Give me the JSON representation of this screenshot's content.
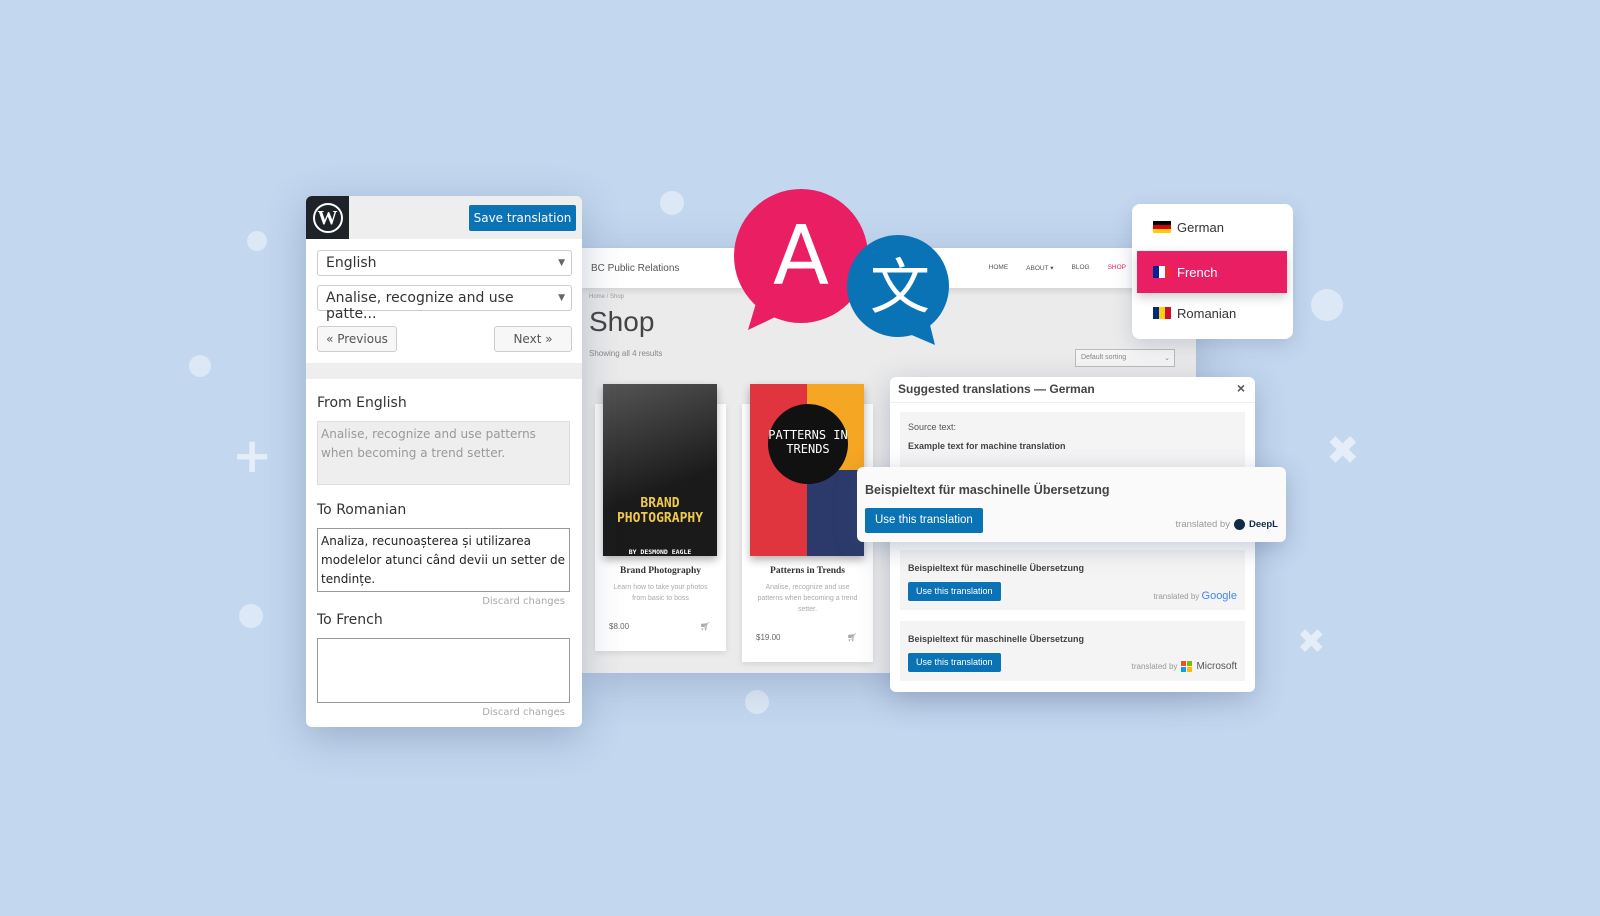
{
  "editor": {
    "save_label": "Save translation",
    "language_select": "English",
    "string_select": "Analise, recognize and use patte...",
    "previous_label": "« Previous",
    "next_label": "Next »",
    "from_label": "From English",
    "from_text": "Analise, recognize and use patterns when becoming a trend setter.",
    "to_romanian_label": "To Romanian",
    "to_romanian_text": "Analiza, recunoașterea și utilizarea modelelor atunci când devii un setter de tendințe.",
    "discard_label": "Discard changes",
    "to_french_label": "To French",
    "to_french_text": ""
  },
  "shop": {
    "site_title": "BC Public Relations",
    "menu": [
      "HOME",
      "ABOUT ▾",
      "BLOG",
      "SHOP"
    ],
    "active_menu_color": "#e91e63",
    "breadcrumb": "Home / Shop",
    "title": "Shop",
    "result_count": "Showing all 4 results",
    "sorting": "Default sorting",
    "products": [
      {
        "name": "Brand Photography",
        "desc": "Learn how to take your photos from basic to boss",
        "price": "$8.00",
        "cover_title": "BRAND PHOTOGRAPHY",
        "cover_author": "BY DESMOND EAGLE"
      },
      {
        "name": "Patterns in Trends",
        "desc": "Analise, recognize and use patterns when becoming a trend setter.",
        "price": "$19.00",
        "cover_title": "PATTERNS IN TRENDS"
      }
    ]
  },
  "suggestions": {
    "title": "Suggested translations — German",
    "close": "×",
    "source_label": "Source text:",
    "source_text": "Example text for machine translation",
    "items": [
      {
        "text": "Beispieltext für maschinelle Übersetzung",
        "button": "Use this translation",
        "by": "translated by",
        "provider": "DeepL"
      },
      {
        "text": "Beispieltext für maschinelle Übersetzung",
        "button": "Use this translation",
        "by": "translated by",
        "provider": "Google"
      },
      {
        "text": "Beispieltext für maschinelle Übersetzung",
        "button": "Use this translation",
        "by": "translated by",
        "provider": "Microsoft"
      }
    ]
  },
  "languages": {
    "items": [
      "German",
      "French",
      "Romanian"
    ],
    "selected": "French",
    "accent": "#e91e63"
  },
  "logo_letters": {
    "a": "A",
    "b": "文"
  },
  "colors": {
    "background": "#c3d7ef",
    "primary_button": "#0a73b5",
    "pink": "#e91e63"
  }
}
